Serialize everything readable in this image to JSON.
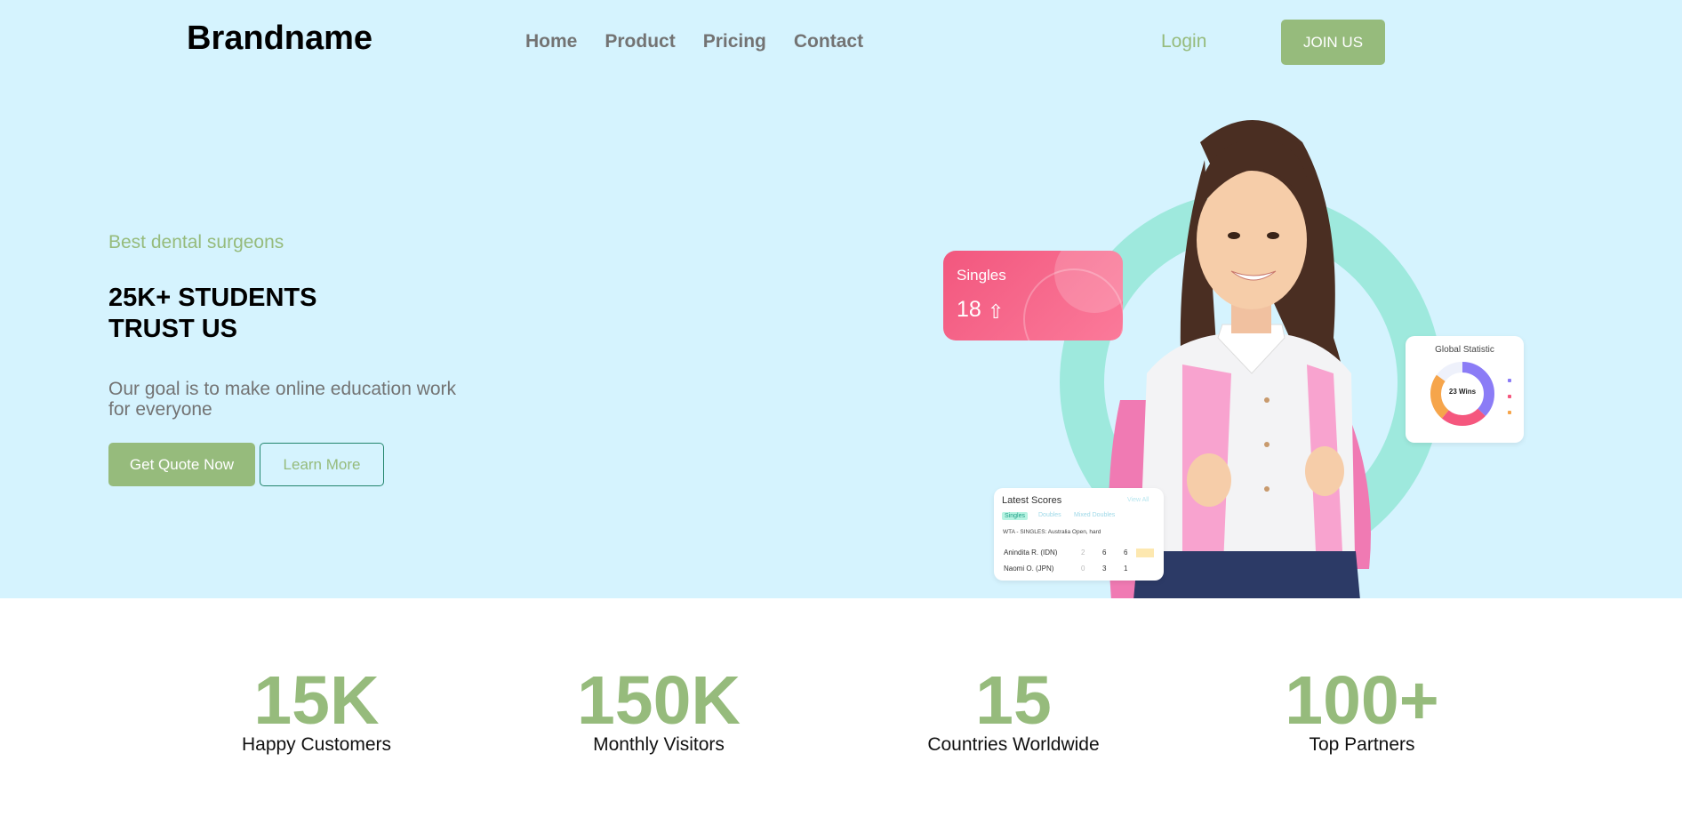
{
  "header": {
    "brand": "Brandname",
    "nav": [
      "Home",
      "Product",
      "Pricing",
      "Contact"
    ],
    "login": "Login",
    "join": "JOIN US"
  },
  "hero": {
    "tagline": "Best dental surgeons",
    "headline": "25K+ STUDENTS TRUST US",
    "goal": "Our goal is to make online education work for everyone",
    "primary_button": "Get Quote Now",
    "secondary_button": "Learn More"
  },
  "illustration": {
    "singles": {
      "title": "Singles",
      "value": "18",
      "arrow": "⇧"
    },
    "global_statistic": {
      "title": "Global Statistic",
      "center_label": "23 Wins",
      "colors": [
        "#8b7cf6",
        "#f5577e",
        "#f6a54b"
      ]
    },
    "latest_scores": {
      "title": "Latest Scores",
      "view_all": "View All",
      "tabs": [
        "Singles",
        "Doubles",
        "Mixed Doubles"
      ],
      "event": "WTA - SINGLES: Australia Open, hard",
      "rows": [
        {
          "player": "Anindita R. (IDN)",
          "s1": "2",
          "s2": "6",
          "s3": "6"
        },
        {
          "player": "Naomi O. (JPN)",
          "s1": "0",
          "s2": "3",
          "s3": "1"
        }
      ]
    }
  },
  "stats": [
    {
      "value": "15K",
      "label": "Happy Customers"
    },
    {
      "value": "150K",
      "label": "Monthly Visitors"
    },
    {
      "value": "15",
      "label": "Countries Worldwide"
    },
    {
      "value": "100+",
      "label": "Top Partners"
    }
  ],
  "colors": {
    "accent": "#96bb7c",
    "hero_bg": "#d5f3fe",
    "nav_text": "#737373"
  }
}
